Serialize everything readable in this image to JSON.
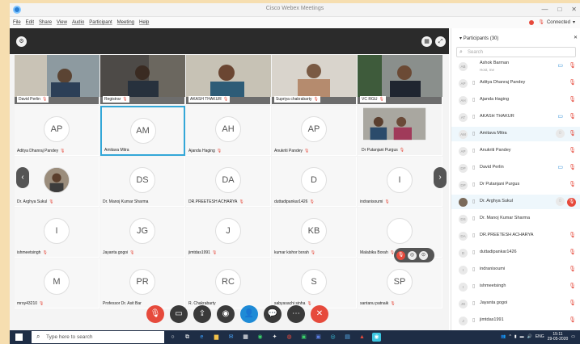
{
  "window": {
    "title": "Cisco Webex Meetings",
    "controls": [
      "—",
      "□",
      "✕"
    ]
  },
  "menu": {
    "items": [
      "File",
      "Edit",
      "Share",
      "View",
      "Audio",
      "Participant",
      "Meeting",
      "Help"
    ],
    "connection_status": "Connected"
  },
  "grid": {
    "tiles": [
      {
        "label": "David Perlin",
        "initials": "",
        "kind": "video"
      },
      {
        "label": "Registrar",
        "initials": "",
        "kind": "video"
      },
      {
        "label": "AKASH THAKUR",
        "initials": "",
        "kind": "video"
      },
      {
        "label": "Supriya chakrabarty",
        "initials": "",
        "kind": "video"
      },
      {
        "label": "VC RGU",
        "initials": "",
        "kind": "video"
      },
      {
        "label": "Aditya Dhanraj Pandey",
        "initials": "AP",
        "kind": "avatar"
      },
      {
        "label": "Amitava Mitra",
        "initials": "AM",
        "kind": "avatar"
      },
      {
        "label": "Ajanda Haging",
        "initials": "AH",
        "kind": "avatar"
      },
      {
        "label": "Anukriti Pandey",
        "initials": "AP",
        "kind": "avatar"
      },
      {
        "label": "Dr Putanjani Purgus",
        "initials": "",
        "kind": "video"
      },
      {
        "label": "Dr. Arghya Sukul",
        "initials": "",
        "kind": "photo"
      },
      {
        "label": "Dr. Manoj Kumar Sharma",
        "initials": "DS",
        "kind": "avatar"
      },
      {
        "label": "DR.PREETESH ACHARYA",
        "initials": "DA",
        "kind": "avatar"
      },
      {
        "label": "duttadipankar1426",
        "initials": "D",
        "kind": "avatar"
      },
      {
        "label": "indranisoumi",
        "initials": "I",
        "kind": "avatar"
      },
      {
        "label": "ishmeetsingh",
        "initials": "I",
        "kind": "avatar"
      },
      {
        "label": "Jayanta gogoi",
        "initials": "JG",
        "kind": "avatar"
      },
      {
        "label": "jimtdas1991",
        "initials": "J",
        "kind": "avatar"
      },
      {
        "label": "kumar kishor borah",
        "initials": "KB",
        "kind": "avatar"
      },
      {
        "label": "Malabika Borah",
        "initials": "",
        "kind": "avatar"
      },
      {
        "label": "mroy43210",
        "initials": "M",
        "kind": "avatar"
      },
      {
        "label": "Professor Dr. Asit Bar",
        "initials": "PR",
        "kind": "avatar"
      },
      {
        "label": "R. Chakrabarty",
        "initials": "RC",
        "kind": "avatar"
      },
      {
        "label": "sabyasachi sinha",
        "initials": "S",
        "kind": "avatar"
      },
      {
        "label": "santanu patnaik",
        "initials": "SP",
        "kind": "avatar"
      }
    ]
  },
  "panel": {
    "header": "Participants (30)",
    "search_placeholder": "Search",
    "participants": [
      {
        "initials": "AB",
        "name": "Ashok Barman",
        "sub": "Host, me",
        "mic": true,
        "cam": true
      },
      {
        "initials": "AP",
        "name": "Aditya Dhanraj Pandey",
        "sub": "",
        "mic": true,
        "cam": false
      },
      {
        "initials": "AH",
        "name": "Ajanda Haging",
        "sub": "",
        "mic": true,
        "cam": false
      },
      {
        "initials": "AT",
        "name": "AKASH THAKUR",
        "sub": "",
        "mic": true,
        "cam": true
      },
      {
        "initials": "AM",
        "name": "Amitava Mitra",
        "sub": "",
        "mic": true,
        "cam": false
      },
      {
        "initials": "AP",
        "name": "Anukriti Pandey",
        "sub": "",
        "mic": true,
        "cam": false
      },
      {
        "initials": "DP",
        "name": "David Perlin",
        "sub": "",
        "mic": true,
        "cam": true
      },
      {
        "initials": "DP",
        "name": "Dr Putanjani Purgus",
        "sub": "",
        "mic": true,
        "cam": false
      },
      {
        "initials": "",
        "name": "Dr. Arghya Sukul",
        "sub": "",
        "mic": true,
        "cam": false
      },
      {
        "initials": "DS",
        "name": "Dr. Manoj Kumar Sharma",
        "sub": "",
        "mic": false,
        "cam": false
      },
      {
        "initials": "DA",
        "name": "DR.PREETESH ACHARYA",
        "sub": "",
        "mic": true,
        "cam": false
      },
      {
        "initials": "D",
        "name": "duttadipankar1426",
        "sub": "",
        "mic": true,
        "cam": false
      },
      {
        "initials": "I",
        "name": "indranisoumi",
        "sub": "",
        "mic": true,
        "cam": false
      },
      {
        "initials": "I",
        "name": "ishmeetsingh",
        "sub": "",
        "mic": true,
        "cam": false
      },
      {
        "initials": "JG",
        "name": "Jayanta gogoi",
        "sub": "",
        "mic": true,
        "cam": false
      },
      {
        "initials": "J",
        "name": "jimtdas1991",
        "sub": "",
        "mic": true,
        "cam": false
      }
    ]
  },
  "taskbar": {
    "search_placeholder": "Type here to search",
    "language": "ENG",
    "time": "15:11",
    "date": "29-05-2020"
  },
  "colors": {
    "accent": "#33a7d8",
    "danger": "#e64a3c",
    "taskbar": "#1e2d45"
  }
}
